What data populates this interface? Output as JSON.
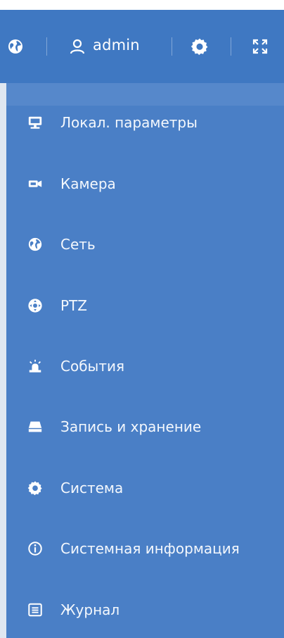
{
  "header": {
    "user_label": "admin",
    "icons": [
      "globe-icon",
      "user-icon",
      "gear-icon",
      "fullscreen-icon"
    ]
  },
  "menu": {
    "items": [
      {
        "label": "Локал. параметры",
        "icon": "monitor-icon"
      },
      {
        "label": "Камера",
        "icon": "camera-icon"
      },
      {
        "label": "Сеть",
        "icon": "globe-icon"
      },
      {
        "label": "PTZ",
        "icon": "ptz-icon"
      },
      {
        "label": "События",
        "icon": "alarm-icon"
      },
      {
        "label": "Запись и хранение",
        "icon": "storage-icon"
      },
      {
        "label": "Система",
        "icon": "gear-icon"
      },
      {
        "label": "Системная информация",
        "icon": "info-icon"
      },
      {
        "label": "Журнал",
        "icon": "log-icon"
      }
    ]
  },
  "colors": {
    "header_bg": "#3f78c2",
    "menu_bg": "#4a7fc6",
    "text": "#f4f8fd"
  }
}
